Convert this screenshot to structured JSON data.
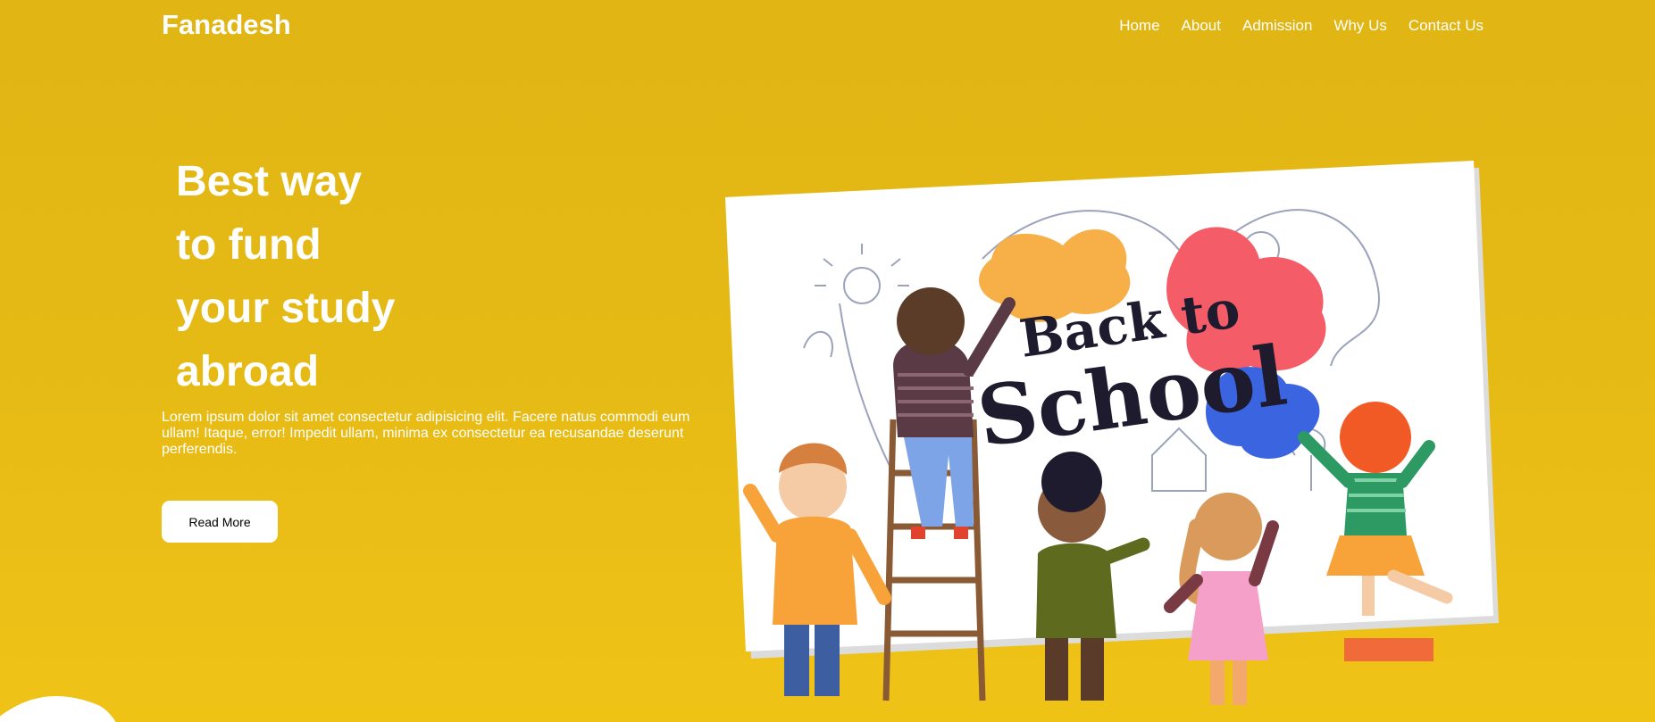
{
  "brand": {
    "name": "Fanadesh"
  },
  "nav": {
    "items": [
      "Home",
      "About",
      "Admission",
      "Why Us",
      "Contact Us"
    ]
  },
  "hero": {
    "title_lines": [
      "Best way",
      "to fund",
      "your study",
      "abroad"
    ],
    "description": "Lorem ipsum dolor sit amet consectetur adipisicing elit. Facere natus commodi eum ullam! Itaque, error! Impedit ullam, minima ex consectetur ea recusandae deserunt perferendis.",
    "button_label": "Read More"
  },
  "illustration": {
    "line1": "Back to",
    "line2": "School"
  },
  "colors": {
    "background": "#e6ba15",
    "text": "#ffffff",
    "button_bg": "#ffffff",
    "button_text": "#000000"
  }
}
